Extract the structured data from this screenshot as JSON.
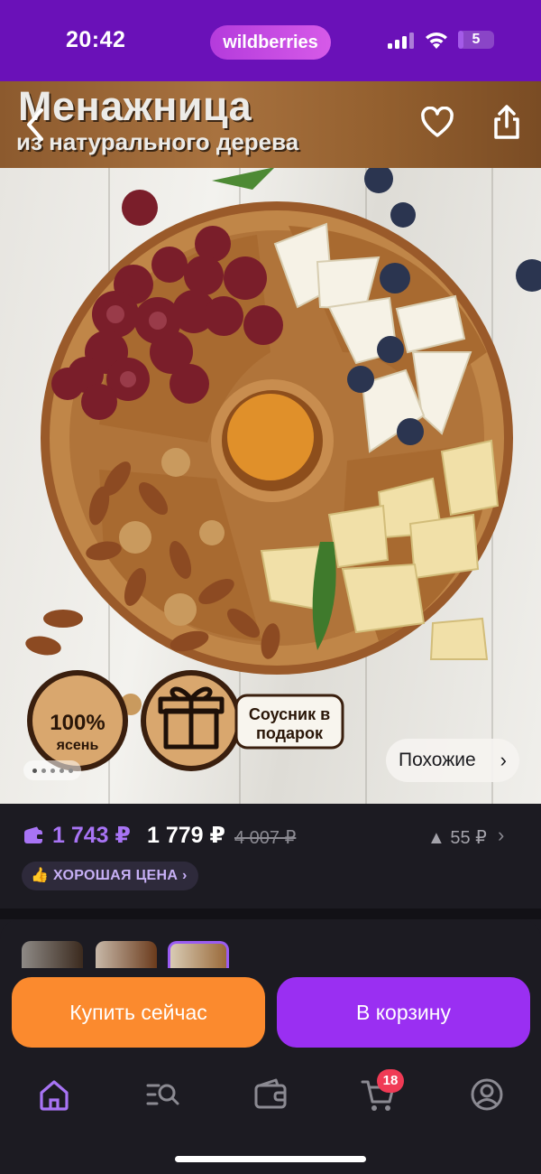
{
  "status_bar": {
    "time": "20:42",
    "brand": "wildberries",
    "battery_level": "5",
    "battery_fraction": 0.05,
    "icons": [
      "cellular-signal-icon",
      "wifi-icon",
      "battery-icon"
    ]
  },
  "product_image": {
    "banner_title": "Менажница",
    "banner_subtitle": "из натурального дерева",
    "badge_material_line1": "100%",
    "badge_material_line2": "ясень",
    "badge_gift_line1": "Соусник в",
    "badge_gift_line2": "подарок",
    "similar_label": "Похожие",
    "gallery_pages": 5,
    "gallery_current": 1,
    "icons": [
      "back-icon",
      "heart-icon",
      "share-icon",
      "chevron-right-icon"
    ]
  },
  "price": {
    "wallet_price": "1 743 ₽",
    "price": "1 779 ₽",
    "old_price": "4 007 ₽",
    "price_change": "▲ 55 ₽",
    "good_price_label": "ХОРОШАЯ ЦЕНА",
    "accent_color": "#a874f5"
  },
  "actions": {
    "buy_now": "Купить сейчас",
    "add_to_cart": "В корзину",
    "buy_color": "#fb8a2e",
    "cart_color": "#9a2ff2"
  },
  "tab_bar": {
    "items": [
      "home-icon",
      "catalog-search-icon",
      "wallet-icon",
      "cart-icon",
      "profile-icon"
    ],
    "cart_count": "18",
    "active": "home-icon"
  }
}
